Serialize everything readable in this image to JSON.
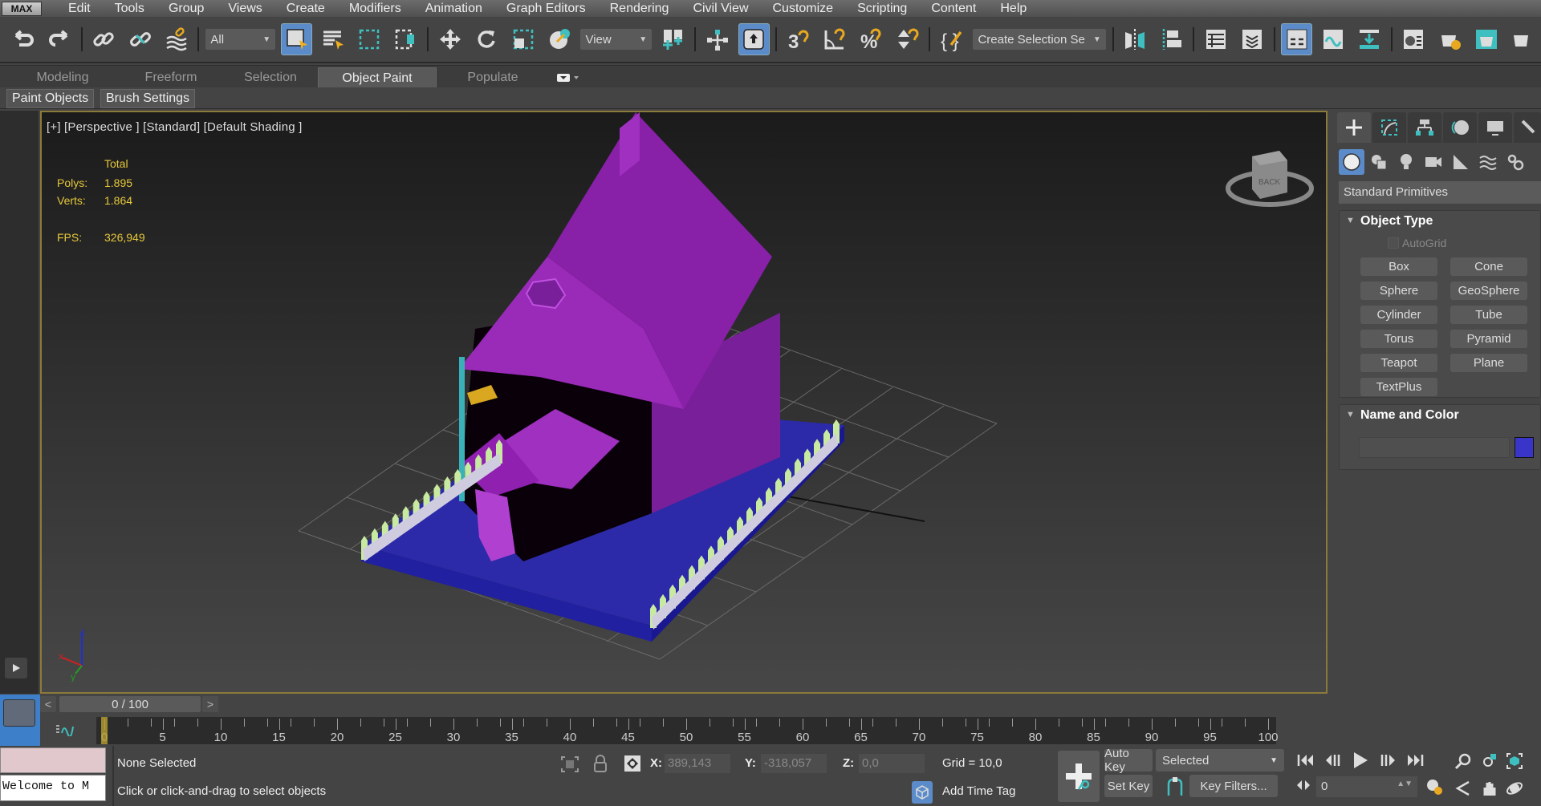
{
  "app": {
    "logo": "MAX"
  },
  "menu": [
    "Edit",
    "Tools",
    "Group",
    "Views",
    "Create",
    "Modifiers",
    "Animation",
    "Graph Editors",
    "Rendering",
    "Civil View",
    "Customize",
    "Scripting",
    "Content",
    "Help"
  ],
  "toolbar": {
    "selection_filter": "All",
    "ref_coord_system": "View",
    "named_selection_set": "Create Selection Se",
    "icons": [
      "undo-icon",
      "redo-icon",
      "link-icon",
      "unlink-icon",
      "bind-space-warp-icon",
      "select-object-icon",
      "select-by-name-icon",
      "rectangular-selection-icon",
      "window-crossing-icon",
      "move-icon",
      "rotate-icon",
      "scale-icon",
      "placement-icon",
      "pivot-icon",
      "select-manipulate-icon",
      "keyboard-shortcut-toggle-icon",
      "snaps-toggle-icon",
      "angle-snap-icon",
      "percent-snap-icon",
      "spinner-snap-icon",
      "edit-named-selection-icon",
      "mirror-icon",
      "align-icon",
      "scene-explorer-icon",
      "layer-explorer-icon",
      "ribbon-toggle-icon",
      "curve-editor-icon",
      "dope-sheet-icon",
      "material-editor-icon",
      "render-setup-icon",
      "rendered-frame-window-icon",
      "render-icon"
    ]
  },
  "ribbon": {
    "tabs": [
      "Modeling",
      "Freeform",
      "Selection",
      "Object Paint",
      "Populate"
    ],
    "active_tab": "Object Paint",
    "subtabs": [
      "Paint Objects",
      "Brush Settings"
    ]
  },
  "viewport": {
    "label": "[+] [Perspective ] [Standard] [Default Shading ]",
    "stats": {
      "header": "Total",
      "polys_label": "Polys:",
      "polys": "1.895",
      "verts_label": "Verts:",
      "verts": "1.864",
      "fps_label": "FPS:",
      "fps": "326,949"
    },
    "viewcube_label": "BACK",
    "axis": {
      "x": "x",
      "y": "y",
      "z": "z"
    }
  },
  "command_panel": {
    "tabs": [
      "create-icon",
      "modify-icon",
      "hierarchy-icon",
      "motion-icon",
      "display-icon",
      "utilities-icon"
    ],
    "categories": [
      "geometry-icon",
      "shapes-icon",
      "lights-icon",
      "cameras-icon",
      "helpers-icon",
      "space-warps-icon",
      "systems-icon"
    ],
    "dropdown": "Standard Primitives",
    "object_type": {
      "title": "Object Type",
      "autogrid": "AutoGrid",
      "autogrid_checked": false,
      "buttons": [
        "Box",
        "Cone",
        "Sphere",
        "GeoSphere",
        "Cylinder",
        "Tube",
        "Torus",
        "Pyramid",
        "Teapot",
        "Plane",
        "TextPlus"
      ]
    },
    "name_and_color": {
      "title": "Name and Color",
      "name_value": "",
      "color": "#3a35c9"
    }
  },
  "timeline": {
    "slider_label": "0 / 100",
    "prev": "<",
    "next": ">",
    "current_frame": 0,
    "total_frames": 100,
    "tick_labels": [
      "0",
      "5",
      "10",
      "15",
      "20",
      "25",
      "30",
      "35",
      "40",
      "45",
      "50",
      "55",
      "60",
      "65",
      "70",
      "75",
      "80",
      "85",
      "90",
      "95",
      "100"
    ]
  },
  "status": {
    "maxscript_output": "Welcome to M",
    "selection": "None Selected",
    "prompt": "Click or click-and-drag to select objects",
    "x_label": "X:",
    "x": "389,143",
    "y_label": "Y:",
    "y": "-318,057",
    "z_label": "Z:",
    "z": "0,0",
    "grid": "Grid = 10,0",
    "add_time_tag": "Add Time Tag",
    "auto_key": "Auto Key",
    "set_key": "Set Key",
    "key_mode": "Selected",
    "key_filters": "Key Filters...",
    "frame_value": "0"
  },
  "colors": {
    "accent": "#5b8cc9",
    "viewport_border": "#8c7a3a",
    "stats_text": "#e6c83a",
    "teal": "#3fbfbf"
  }
}
